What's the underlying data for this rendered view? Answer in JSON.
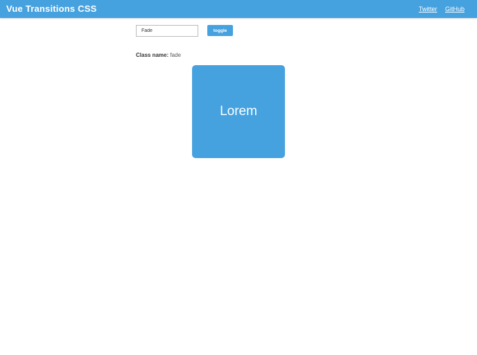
{
  "header": {
    "title": "Vue Transitions CSS",
    "links": [
      "Twitter",
      "GitHub"
    ]
  },
  "controls": {
    "select_value": "Fade",
    "toggle_label": "toggle"
  },
  "class_name": {
    "label": "Class name:",
    "value": "fade"
  },
  "box": {
    "text": "Lorem"
  },
  "colors": {
    "accent": "#46a1df"
  }
}
